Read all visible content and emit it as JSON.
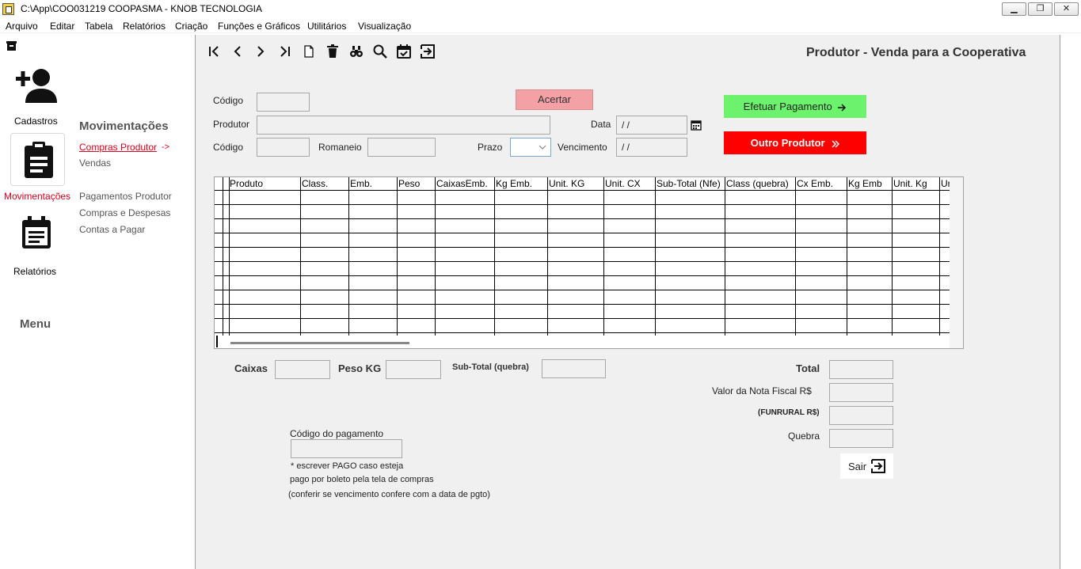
{
  "window": {
    "title": "C:\\App\\COO031219  COOPASMA - KNOB TECNOLOGIA",
    "min_glyph": "▁",
    "max_glyph": "❐",
    "close_glyph": "✕"
  },
  "menu": [
    "Arquivo",
    "Editar",
    "Tabela",
    "Relatórios",
    "Criação",
    "Funções e Gráficos",
    "Utilitários",
    "Visualização"
  ],
  "sidebar": {
    "cadastros": "Cadastros",
    "movimentacoes": "Movimentações",
    "relatorios": "Relatórios",
    "menu": "Menu",
    "sub_heading": "Movimentações",
    "links": {
      "compras_produtor": "Compras Produtor",
      "arrow": "->",
      "vendas": "Vendas",
      "pagamentos_produtor": "Pagamentos Produtor",
      "compras_despesas": "Compras e Despesas",
      "contas_pagar": "Contas a Pagar"
    },
    "active_color": "#e0001b"
  },
  "form": {
    "title": "Produtor - Venda para a Cooperativa",
    "labels": {
      "codigo": "Código",
      "produtor": "Produtor",
      "codigo2": "Código",
      "romaneio": "Romaneio",
      "prazo": "Prazo",
      "data": "Data",
      "vencimento": "Vencimento"
    },
    "values": {
      "codigo": "",
      "produtor": "",
      "codigo2": "",
      "romaneio": "",
      "prazo": "",
      "data": " /  /",
      "vencimento": " /  /"
    },
    "buttons": {
      "acertar": "Acertar",
      "efetuar_pagamento": "Efetuar Pagamento",
      "outro_produtor": "Outro Produtor",
      "sair": "Sair"
    }
  },
  "grid": {
    "columns": [
      "Produto",
      "Class.",
      "Emb.",
      "Peso",
      "CaixasEmb.",
      "Kg Emb.",
      "Unit. KG",
      "Unit. CX",
      "Sub-Total (Nfe)",
      "Class (quebra)",
      "Cx Emb.",
      "Kg Emb",
      "Unit. Kg",
      "Un"
    ],
    "rows": 10
  },
  "totals": {
    "caixas_label": "Caixas",
    "peso_kg_label": "Peso KG",
    "sub_total_label": "Sub-Total (quebra)",
    "total_label": "Total",
    "valor_nota_label": "Valor da Nota Fiscal R$",
    "funrural_label": "(FUNRURAL R$)",
    "quebra_label": "Quebra",
    "caixas": "",
    "peso_kg": "",
    "sub_total": "",
    "total": "",
    "valor_nota": "",
    "funrural": "",
    "quebra": ""
  },
  "pagamento": {
    "label": "Código do pagamento",
    "value": "",
    "note1": "* escrever PAGO caso esteja",
    "note2": "pago por boleto pela tela de compras",
    "note3": "(conferir se vencimento confere com a data de pgto)"
  }
}
